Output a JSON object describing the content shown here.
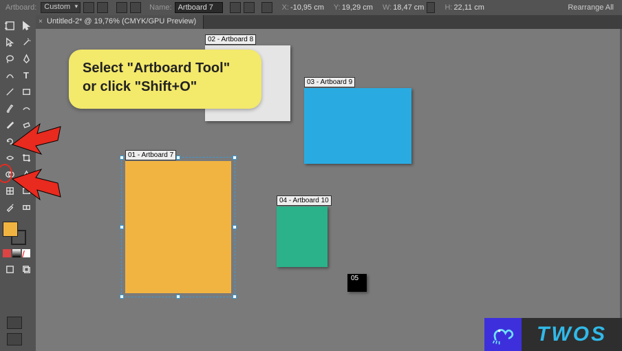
{
  "options_bar": {
    "preset_label": "Artboard:",
    "preset_value": "Custom",
    "name_label": "Name:",
    "name_value": "Artboard 7",
    "x_label": "X:",
    "x_value": "-10,95 cm",
    "y_label": "Y:",
    "y_value": "19,29 cm",
    "w_label": "W:",
    "w_value": "18,47 cm",
    "h_label": "H:",
    "h_value": "22,11 cm",
    "rearrange": "Rearrange All"
  },
  "document_tab": {
    "title": "Untitled-2* @ 19,76% (CMYK/GPU Preview)"
  },
  "tooltip": {
    "line1": "Select \"Artboard Tool\"",
    "line2": "or click \"Shift+O\""
  },
  "artboards": {
    "ab7": "01 - Artboard 7",
    "ab8": "02 - Artboard 8",
    "ab9": "03 - Artboard 9",
    "ab10": "04 - Artboard 10",
    "ab5": "05"
  },
  "toolbar": {
    "tools": [
      [
        "artboard-tool",
        "selection-tool"
      ],
      [
        "direct-selection-tool",
        "magic-wand-tool"
      ],
      [
        "lasso-tool",
        "pen-tool"
      ],
      [
        "curvature-tool",
        "type-tool"
      ],
      [
        "line-tool",
        "rectangle-tool"
      ],
      [
        "paintbrush-tool",
        "shaper-tool"
      ],
      [
        "pencil-tool",
        "eraser-tool"
      ],
      [
        "rotate-tool",
        "scale-tool"
      ],
      [
        "width-tool",
        "free-transform-tool"
      ],
      [
        "shape-builder-tool",
        "perspective-tool"
      ],
      [
        "mesh-tool",
        "gradient-tool"
      ],
      [
        "eyedropper-tool",
        "blend-tool"
      ],
      [
        "symbol-sprayer-tool",
        "graph-tool"
      ],
      [
        "slice-tool",
        "hand-tool"
      ]
    ]
  },
  "watermark": {
    "text": "TWOS"
  }
}
